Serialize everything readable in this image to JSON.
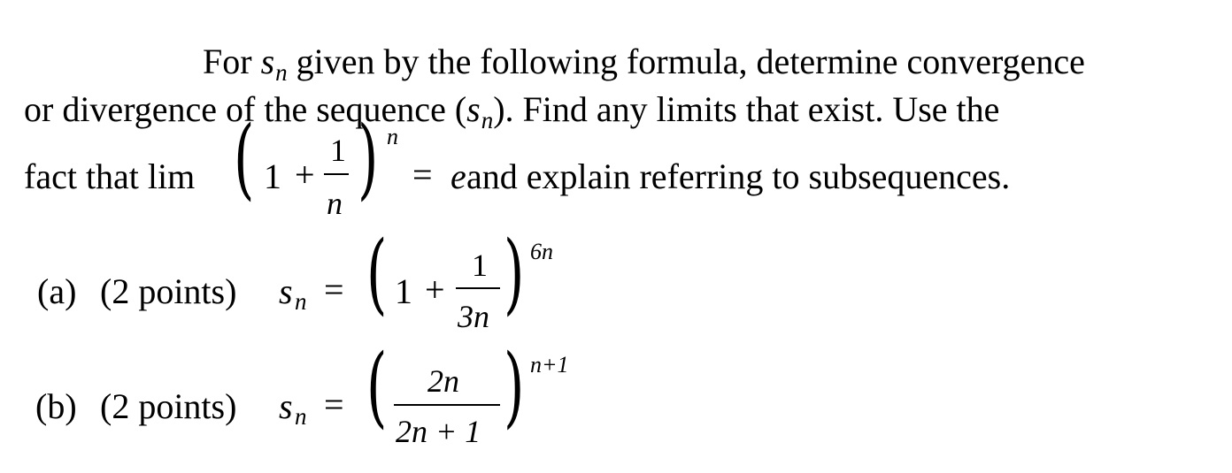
{
  "problem": {
    "intro_line1_pre": "For ",
    "s_var": "s",
    "n_sub": "n",
    "intro_line1_post": " given by the following formula, determine convergence",
    "intro_line2_pre": "or divergence of the sequence (",
    "intro_line2_post": ").  Find any limits that exist.  Use the",
    "intro_line3_pre": "fact that lim",
    "hint_one": "1",
    "hint_plus": "+",
    "hint_num": "1",
    "hint_den": "n",
    "hint_exp": "n",
    "hint_eq": "=",
    "hint_e": "e",
    "intro_line3_post": " and explain referring to subsequences."
  },
  "parts": [
    {
      "label": "(a)",
      "points": "(2 points)",
      "lhs_var": "s",
      "lhs_sub": "n",
      "eq": "=",
      "one": "1",
      "plus": "+",
      "num": "1",
      "den": "3n",
      "exp": "6n"
    },
    {
      "label": "(b)",
      "points": "(2 points)",
      "lhs_var": "s",
      "lhs_sub": "n",
      "eq": "=",
      "num": "2n",
      "den": "2n + 1",
      "exp": "n+1"
    }
  ]
}
